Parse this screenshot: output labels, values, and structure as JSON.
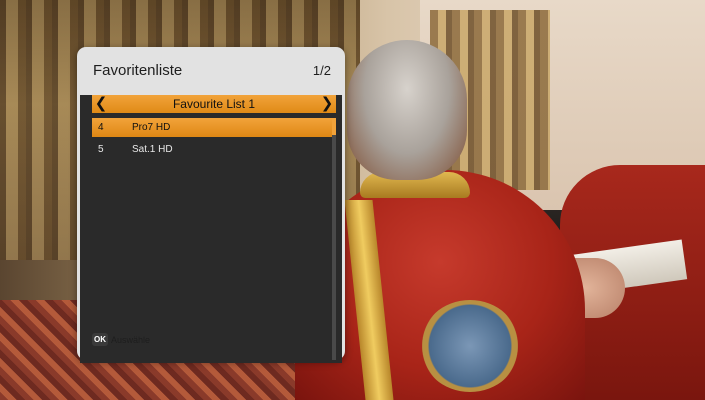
{
  "panel": {
    "title": "Favoritenliste",
    "page": "1/2"
  },
  "group": {
    "name": "Favourite List 1",
    "prev_icon": "chevron-left-icon",
    "next_icon": "chevron-right-icon"
  },
  "channels": [
    {
      "number": "4",
      "name": "Pro7 HD",
      "selected": true
    },
    {
      "number": "5",
      "name": "Sat.1 HD",
      "selected": false
    }
  ],
  "footer": {
    "key": "OK",
    "label": "Auswähle"
  },
  "colors": {
    "accent": "#f0a030",
    "panel_bg": "#e2e2e2",
    "list_bg": "#2a2a2a"
  }
}
